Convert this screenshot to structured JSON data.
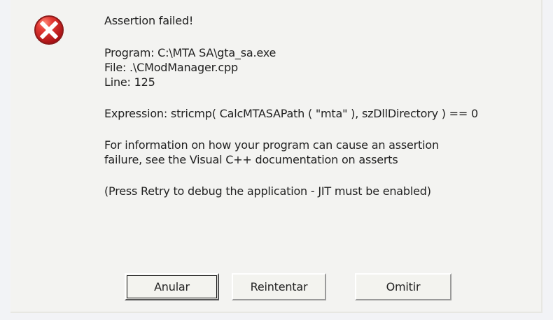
{
  "dialog": {
    "icon": "error-icon",
    "message": {
      "title": "Assertion failed!",
      "program_line": "Program: C:\\MTA SA\\gta_sa.exe",
      "file_line": "File: .\\CModManager.cpp",
      "line_line": "Line: 125",
      "expression_line": "Expression: stricmp( CalcMTASAPath ( \"mta\" ), szDllDirectory ) == 0",
      "info_line_1": "For information on how your program can cause an assertion",
      "info_line_2": "failure, see the Visual C++ documentation on asserts",
      "retry_line": "(Press Retry to debug the application - JIT must be enabled)"
    },
    "buttons": {
      "abort_label": "Anular",
      "retry_label": "Reintentar",
      "ignore_label": "Omitir"
    }
  },
  "colors": {
    "dialog_background": "#f3f3f1",
    "icon_red": "#c92424",
    "icon_white": "#ffffff"
  }
}
